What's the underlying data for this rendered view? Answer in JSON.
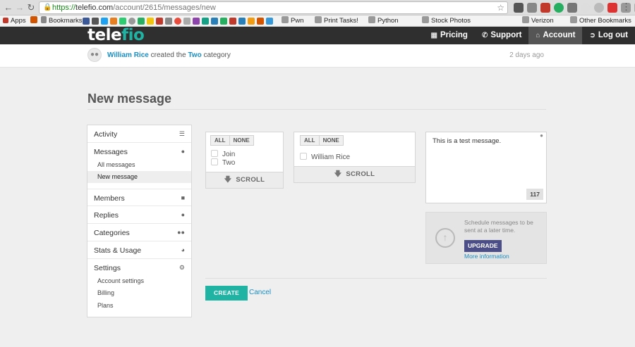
{
  "browser": {
    "url_secure": "https://",
    "url_host": "telefio.com",
    "url_path": "/account/2615/messages/new",
    "bookmarks": {
      "apps": "Apps",
      "bookmarks": "Bookmarks",
      "pwn": "Pwn",
      "print_tasks": "Print Tasks!",
      "python": "Python",
      "stock_photos": "Stock Photos",
      "verizon": "Verizon",
      "other": "Other Bookmarks"
    }
  },
  "header": {
    "logo_part1": "tele",
    "logo_part2": "fio",
    "nav": [
      {
        "label": "Pricing",
        "icon": "bar-chart-icon"
      },
      {
        "label": "Support",
        "icon": "phone-icon"
      },
      {
        "label": "Account",
        "icon": "home-icon"
      },
      {
        "label": "Log out",
        "icon": "logout-icon"
      }
    ]
  },
  "activity": {
    "user": "William Rice",
    "text_mid": "created the",
    "category": "Two",
    "text_end": "category",
    "time": "2 days ago"
  },
  "page": {
    "title": "New message"
  },
  "sidebar": {
    "items": [
      {
        "label": "Activity",
        "icon": "list-icon"
      },
      {
        "label": "Messages",
        "icon": "chat-icon"
      },
      {
        "label": "Members",
        "icon": "person-icon"
      },
      {
        "label": "Replies",
        "icon": "speech-bubble-icon"
      },
      {
        "label": "Categories",
        "icon": "group-icon"
      },
      {
        "label": "Stats & Usage",
        "icon": "gauge-icon"
      },
      {
        "label": "Settings",
        "icon": "gears-icon"
      }
    ],
    "messages_sub": [
      "All messages",
      "New message"
    ],
    "settings_sub": [
      "Account settings",
      "Billing",
      "Plans"
    ]
  },
  "categories_picker": {
    "all_label": "ALL",
    "none_label": "NONE",
    "options": [
      "Join",
      "Two"
    ],
    "scroll_label": "SCROLL"
  },
  "members_picker": {
    "all_label": "ALL",
    "none_label": "NONE",
    "options": [
      "William Rice"
    ],
    "scroll_label": "SCROLL"
  },
  "message": {
    "text": "This is a test message.",
    "char_count": "117"
  },
  "upgrade": {
    "text": "Schedule messages to be sent at a later time.",
    "button": "UPGRADE",
    "link": "More information"
  },
  "form": {
    "create": "CREATE",
    "cancel": "Cancel"
  },
  "colors": {
    "brand_teal": "#1fb3a4",
    "link_blue": "#1a8ec1",
    "header_dark": "#2f2f2f",
    "upgrade_purple": "#4c4f87"
  }
}
